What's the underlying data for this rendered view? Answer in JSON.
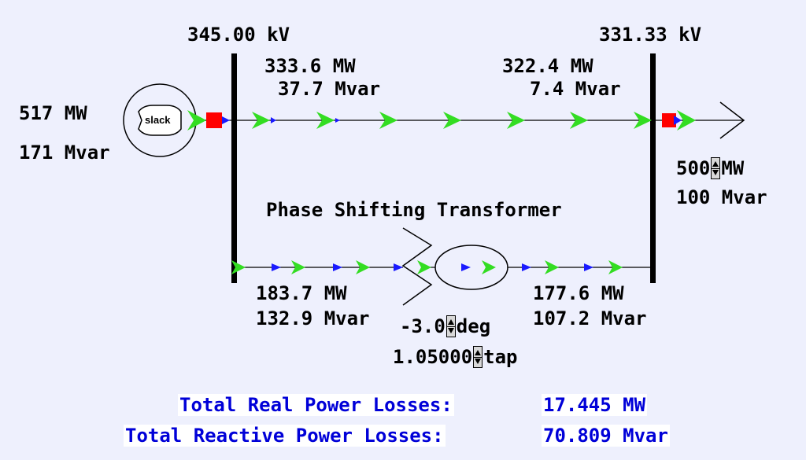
{
  "buses": {
    "left_voltage": "345.00 kV",
    "right_voltage": "331.33 kV"
  },
  "generator": {
    "mw": "517 MW",
    "mvar": "171 Mvar",
    "label": "slack"
  },
  "top_line": {
    "from_mw": "333.6 MW",
    "from_mvar": "37.7 Mvar",
    "to_mw": "322.4 MW",
    "to_mvar": "7.4 Mvar"
  },
  "load": {
    "mw_value": "500",
    "mw_unit": "MW",
    "mvar": "100 Mvar"
  },
  "transformer": {
    "title": "Phase Shifting Transformer",
    "from_mw": "183.7 MW",
    "from_mvar": "132.9 Mvar",
    "to_mw": "177.6 MW",
    "to_mvar": "107.2 Mvar",
    "phase_value": "-3.0",
    "phase_unit": "deg",
    "tap_value": "1.05000",
    "tap_unit": "tap"
  },
  "losses": {
    "real_label": "Total Real Power Losses:",
    "real_value": "17.445 MW",
    "reactive_label": "Total Reactive Power Losses:",
    "reactive_value": "70.809 Mvar"
  },
  "colors": {
    "background": "#eef0fd",
    "flow_mw": "#33dd22",
    "flow_mvar": "#1a1aff",
    "breaker": "#ff0000",
    "loss_text": "#0000d8"
  }
}
